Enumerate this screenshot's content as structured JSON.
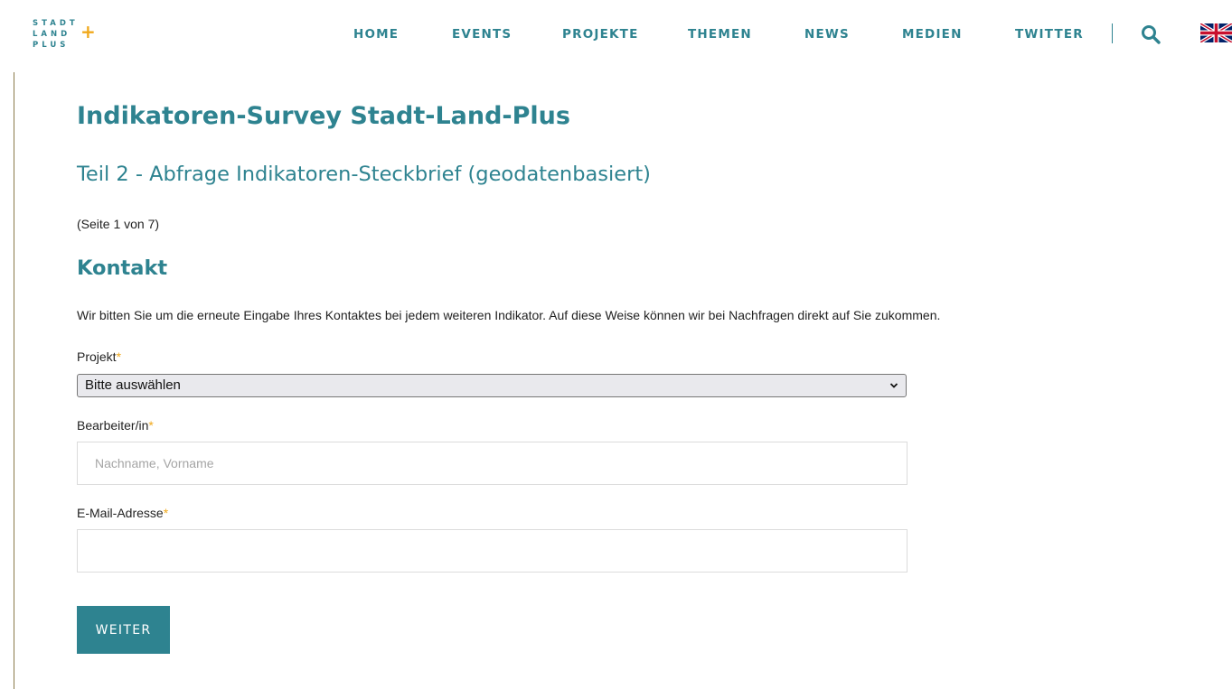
{
  "logo": {
    "line1": "STADT",
    "line2": "LAND",
    "line3": "PLUS",
    "plus": "+"
  },
  "nav": {
    "items": [
      "HOME",
      "EVENTS",
      "PROJEKTE",
      "THEMEN",
      "NEWS",
      "MEDIEN",
      "TWITTER"
    ],
    "search_icon": "search-icon",
    "language_icon": "uk-flag-icon"
  },
  "page": {
    "title": "Indikatoren-Survey Stadt-Land-Plus",
    "subtitle": "Teil 2 - Abfrage Indikatoren-Steckbrief (geodatenbasiert)",
    "page_indicator": "(Seite 1 von 7)",
    "section_title": "Kontakt",
    "intro": "Wir bitten Sie um die erneute Eingabe Ihres Kontaktes bei jedem weiteren Indikator. Auf diese Weise können wir bei Nachfragen direkt auf Sie zukommen."
  },
  "form": {
    "required_mark": "*",
    "projekt": {
      "label": "Projekt",
      "selected": "Bitte auswählen"
    },
    "bearbeiter": {
      "label": "Bearbeiter/in",
      "value": "",
      "placeholder": "Nachname, Vorname"
    },
    "email": {
      "label": "E-Mail-Adresse",
      "value": "",
      "placeholder": ""
    },
    "submit_label": "WEITER"
  },
  "colors": {
    "brand": "#2e8390",
    "accent": "#f0a91c",
    "text": "#222222"
  }
}
